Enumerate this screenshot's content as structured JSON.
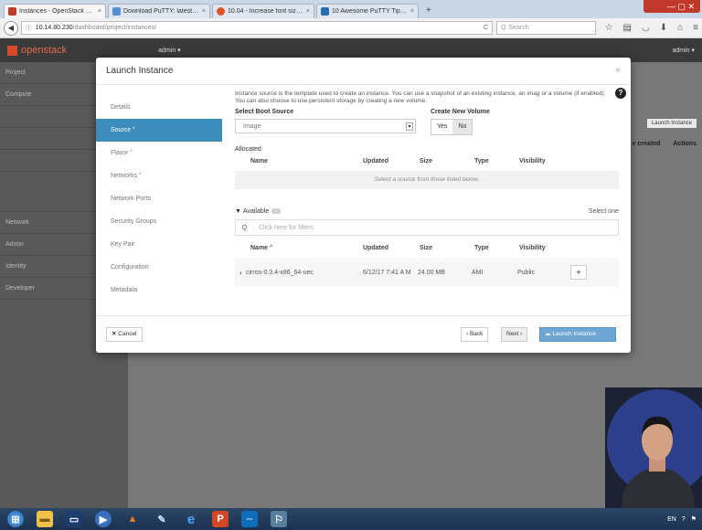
{
  "browser": {
    "tabs": [
      {
        "label": "Instances - OpenStack Dashb",
        "color": "#c0392b",
        "active": true
      },
      {
        "label": "Download PuTTY: latest rele",
        "color": "#5a8fd6",
        "active": false
      },
      {
        "label": "10.04 - Increase font size of",
        "color": "#e0552e",
        "active": false
      },
      {
        "label": "10 Awesome PuTTY Tips and",
        "color": "#2b6cb3",
        "active": false
      }
    ],
    "close_glyph": "×",
    "new_tab_glyph": "+",
    "url_host": "10.14.80.230",
    "url_path": "/dashboard/project/instances/",
    "search_placeholder": "Search",
    "window_controls": "— ▢ ✕"
  },
  "openstack": {
    "brand": "openstack",
    "project_selector": "admin ▾",
    "user_menu": "admin ▾",
    "sidebar": [
      "Project",
      "Compute",
      "",
      "",
      "",
      "Access &",
      "Network",
      "Admin",
      "Identity",
      "Developer"
    ],
    "bg_launch_button": "Launch Instance",
    "bg_headers": [
      "e created",
      "Actions"
    ]
  },
  "modal": {
    "title": "Launch Instance",
    "close": "×",
    "steps": [
      {
        "label": "Details",
        "required": false,
        "active": false
      },
      {
        "label": "Source",
        "required": true,
        "active": true
      },
      {
        "label": "Flavor",
        "required": true,
        "active": false
      },
      {
        "label": "Networks",
        "required": true,
        "active": false
      },
      {
        "label": "Network Ports",
        "required": false,
        "active": false
      },
      {
        "label": "Security Groups",
        "required": false,
        "active": false
      },
      {
        "label": "Key Pair",
        "required": false,
        "active": false
      },
      {
        "label": "Configuration",
        "required": false,
        "active": false
      },
      {
        "label": "Metadata",
        "required": false,
        "active": false
      }
    ],
    "description": "Instance source is the template used to create an instance. You can use a snapshot of an existing instance, an imag or a volume (if enabled). You can also choose to use persistent storage by creating a new volume.",
    "boot_source_label": "Select Boot Source",
    "boot_source_value": "Image",
    "new_volume_label": "Create New Volume",
    "new_volume_yes": "Yes",
    "new_volume_no": "No",
    "allocated_label": "Allocated",
    "columns": {
      "name": "Name",
      "updated": "Updated",
      "size": "Size",
      "type": "Type",
      "visibility": "Visibility"
    },
    "allocated_empty": "Select a source from those listed below.",
    "available_label": "Available",
    "available_count": "1",
    "select_one": "Select one",
    "filter_placeholder": "Click here for filters.",
    "available_rows": [
      {
        "name": "cirros-0.3.4-x86_64-uec",
        "updated": "6/12/17 7:41 A M",
        "size": "24.00 MB",
        "type": "AMI",
        "visibility": "Public"
      }
    ],
    "cancel": "Cancel",
    "back": "‹ Back",
    "next": "Next ›",
    "launch": "Launch Instance"
  },
  "taskbar": {
    "tray_lang": "EN"
  }
}
